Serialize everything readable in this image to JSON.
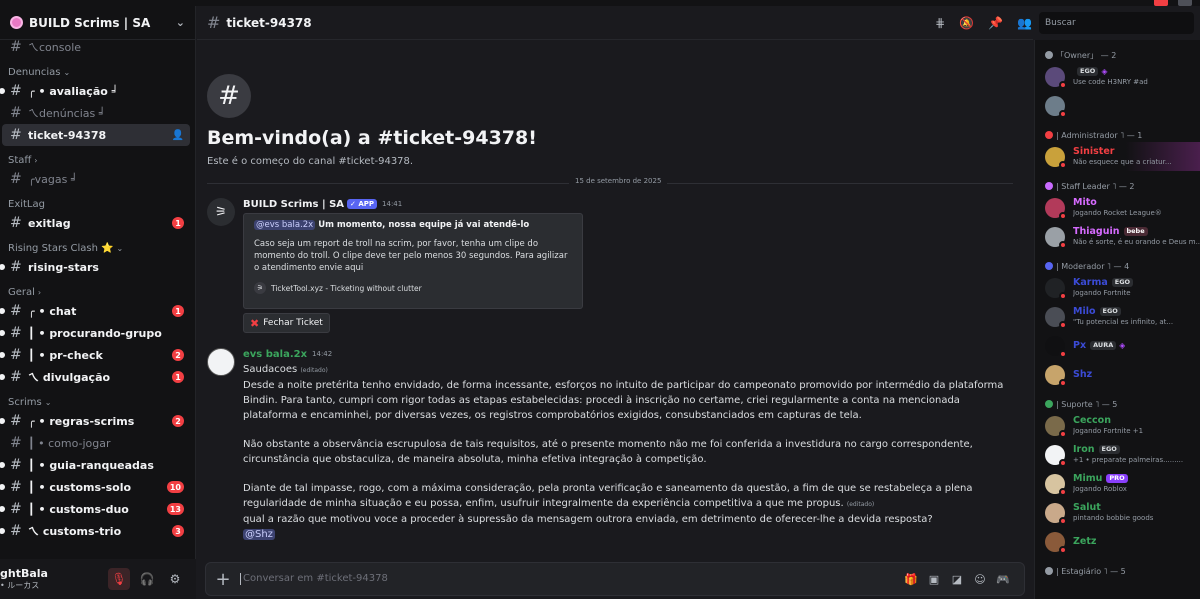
{
  "window": {
    "title_fragment": "Build Scrims | SA"
  },
  "server": {
    "name": "BUILD Scrims | SA"
  },
  "sidebar": {
    "items": [
      {
        "type": "channel",
        "name": "ㄟconsole",
        "unread": false,
        "bold": false
      },
      {
        "type": "category",
        "name": "Denuncias",
        "chevron": "⌄"
      },
      {
        "type": "channel",
        "name": "╭ • avaliação ╛",
        "bold": true,
        "dot": true
      },
      {
        "type": "channel",
        "name": "ㄟdenúncias ╛",
        "bold": false
      },
      {
        "type": "channel",
        "name": "ticket-94378",
        "active": true
      },
      {
        "type": "category",
        "name": "Staff",
        "chevron": "›"
      },
      {
        "type": "channel",
        "name": "╭vagas ╛",
        "bold": false
      },
      {
        "type": "category",
        "name": "ExitLag",
        "chevron": ""
      },
      {
        "type": "channel",
        "name": "exitlag",
        "bold": true,
        "badge": "1"
      },
      {
        "type": "category",
        "name": "Rising Stars Clash ⭐",
        "chevron": "⌄"
      },
      {
        "type": "channel",
        "name": "rising-stars",
        "bold": true,
        "dot": true
      },
      {
        "type": "category",
        "name": "Geral",
        "chevron": "›"
      },
      {
        "type": "channel",
        "name": "╭ • chat",
        "bold": true,
        "dot": true,
        "badge": "1"
      },
      {
        "type": "channel",
        "name": "┃ • procurando-grupo",
        "bold": true,
        "dot": true
      },
      {
        "type": "channel",
        "name": "┃ • pr-check",
        "bold": true,
        "dot": true,
        "badge": "2"
      },
      {
        "type": "channel",
        "name": "ㄟ divulgação",
        "bold": true,
        "dot": true,
        "badge": "1"
      },
      {
        "type": "category",
        "name": "Scrims",
        "chevron": "⌄"
      },
      {
        "type": "channel",
        "name": "╭ • regras-scrims",
        "bold": true,
        "dot": true,
        "badge": "2"
      },
      {
        "type": "channel",
        "name": "┃ • como-jogar",
        "bold": false
      },
      {
        "type": "channel",
        "name": "┃ • guia-ranqueadas",
        "bold": true,
        "dot": true
      },
      {
        "type": "channel",
        "name": "┃ • customs-solo",
        "bold": true,
        "dot": true,
        "badge": "10"
      },
      {
        "type": "channel",
        "name": "┃ • customs-duo",
        "bold": true,
        "dot": true,
        "badge": "13"
      },
      {
        "type": "channel",
        "name": "ㄟ customs-trio",
        "bold": true,
        "dot": true,
        "badge": "3"
      }
    ]
  },
  "user_panel": {
    "name": "ghtBala",
    "status": "• ルーカス"
  },
  "channel": {
    "name": "ticket-94378"
  },
  "search": {
    "placeholder": "Buscar"
  },
  "welcome": {
    "title": "Bem-vindo(a) a #ticket-94378!",
    "subtitle": "Este é o começo do canal #ticket-94378."
  },
  "divider_date": "15 de setembro de 2025",
  "bot_message": {
    "author": "BUILD Scrims | SA",
    "app_tag": "✓ APP",
    "time": "14:41",
    "embed_mention": "@evs bala.2x",
    "embed_title": "Um momento, nossa equipe já vai atendê-lo",
    "embed_desc": "Caso seja um report de troll na scrim, por favor, tenha um clipe do momento do troll. O clipe deve ter pelo menos 30 segundos. Para agilizar o atendimento envie aqui",
    "embed_footer": "TicketTool.xyz - Ticketing without clutter",
    "button": "Fechar Ticket"
  },
  "user_message": {
    "author": "evs bala.2x",
    "author_color": "#3ba55d",
    "time": "14:42",
    "line1": "Saudacoes",
    "edited": "(editado)",
    "p1": "Desde a noite pretérita tenho envidado, de forma incessante, esforços no intuito de participar do campeonato promovido por intermédio da plataforma Bindin. Para tanto, cumpri com rigor todas as etapas estabelecidas: procedi à inscrição no certame, criei regularmente a conta na mencionada plataforma e encaminhei, por diversas vezes, os registros comprobatórios exigidos, consubstanciados em capturas de tela.",
    "p2": "Não obstante a observância escrupulosa de tais requisitos, até o presente momento não me foi conferida a investidura no cargo correspondente, circunstância que obstaculiza, de maneira absoluta, minha efetiva integração à competição.",
    "p3": "Diante de tal impasse, rogo, com a máxima consideração, pela pronta verificação e saneamento da questão, a fim de que se restabeleça a plena regularidade de minha situação e eu possa, enfim, usufruir integralmente da experiência competitiva a que me propus.",
    "p4": "qual a razão que motivou voce a proceder à supressão da mensagem outrora enviada, em detrimento de oferecer-lhe a devida resposta?",
    "mention": "@Shz"
  },
  "composer": {
    "placeholder": "Conversar em #ticket-94378"
  },
  "members": {
    "groups": [
      {
        "label": "「Owner」 — 2",
        "color": "#949ba4",
        "people": [
          {
            "name": "",
            "color": "#f2f3f5",
            "tag": "EGO",
            "gem": true,
            "status": "Use code H3NRY #ad",
            "av": "#5b4a7a"
          },
          {
            "name": "",
            "color": "#f2f3f5",
            "status": "",
            "av": "#6d7d8a"
          }
        ]
      },
      {
        "label": "| Administrador ˥ — 1",
        "color": "#f23f43",
        "people": [
          {
            "name": "Sinister",
            "color": "#f23f43",
            "status": "Não esquece que a criatur...",
            "av": "#c9a13b",
            "hl": true
          }
        ]
      },
      {
        "label": "| Staff Leader ˥ — 2",
        "color": "#c96bff",
        "people": [
          {
            "name": "Mito",
            "color": "#d66bff",
            "status": "Jogando Rocket League®",
            "av": "#b23a5a"
          },
          {
            "name": "Thiaguin",
            "color": "#d66bff",
            "tag": "bebe",
            "status": "Não é sorte, é eu orando e Deus m...",
            "av": "#9aa0a6"
          }
        ]
      },
      {
        "label": "| Moderador ˥ — 4",
        "color": "#5865f2",
        "people": [
          {
            "name": "Karma",
            "color": "#3b4bd6",
            "tag": "EGO",
            "status": "Jogando Fortnite",
            "av": "#202225"
          },
          {
            "name": "Milo",
            "color": "#3b4bd6",
            "tag": "EGO",
            "status": "\"Tu potencial es infinito, at...",
            "av": "#4a4d55"
          },
          {
            "name": "Px",
            "color": "#3b4bd6",
            "tag": "AURA",
            "gem": true,
            "status": "",
            "av": "#101012"
          },
          {
            "name": "Shz",
            "color": "#3b4bd6",
            "status": "",
            "av": "#c7a46b"
          }
        ]
      },
      {
        "label": "| Suporte ˥ — 5",
        "color": "#3ba55d",
        "people": [
          {
            "name": "Ceccon",
            "color": "#3ba55d",
            "status": "Jogando Fortnite +1",
            "av": "#7a6a4a"
          },
          {
            "name": "Iron",
            "color": "#3ba55d",
            "tag": "EGO",
            "status": "+1 • preparate palmeiras.........",
            "av": "#f2f3f5"
          },
          {
            "name": "Mimu",
            "color": "#3ba55d",
            "tag": "PRO",
            "status": "Jogando Roblox",
            "av": "#d7c4a0"
          },
          {
            "name": "Salut",
            "color": "#3ba55d",
            "status": "pintando bobbie goods",
            "av": "#c9a98a"
          },
          {
            "name": "Zetz",
            "color": "#3ba55d",
            "status": "",
            "av": "#8a5a3a"
          }
        ]
      },
      {
        "label": "| Estagiário ˥ — 5",
        "color": "#949ba4",
        "people": []
      }
    ]
  }
}
